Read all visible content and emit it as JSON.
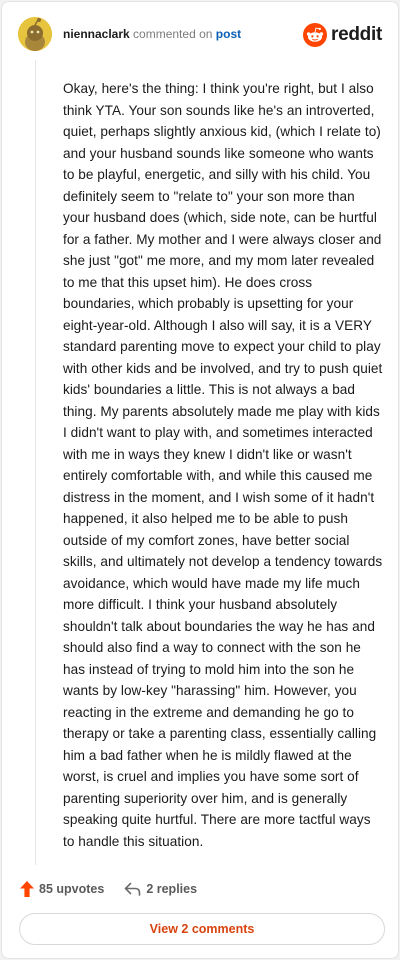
{
  "comment": {
    "username": "niennaclark",
    "action_text": "commented on",
    "post_link": "post",
    "body": "Okay, here's the thing: I think you're right, but I also think YTA. Your son sounds like he's an introverted, quiet, perhaps slightly anxious kid, (which I relate to) and your husband sounds like someone who wants to be playful, energetic, and silly with his child. You definitely seem to \"relate to\" your son more than your husband does (which, side note, can be hurtful for a father. My mother and I were always closer and she just \"got\" me more, and my mom later revealed to me that this upset him). He does cross boundaries, which probably is upsetting for your eight-year-old. Although I also will say, it is a VERY standard parenting move to expect your child to play with other kids and be involved, and try to push quiet kids' boundaries a little. This is not always a bad thing. My parents absolutely made me play with kids I didn't want to play with, and sometimes interacted with me in ways they knew I didn't like or wasn't entirely comfortable with, and while this caused me distress in the moment, and I wish some of it hadn't happened, it also helped me to be able to push outside of my comfort zones, have better social skills, and ultimately not develop a tendency towards avoidance, which would have made my life much more difficult. I think your husband absolutely shouldn't talk about boundaries the way he has and should also find a way to connect with the son he has instead of trying to mold him into the son he wants by low-key \"harassing\" him. However, you reacting in the extreme and demanding he go to therapy or take a parenting class, essentially calling him a bad father when he is mildly flawed at the worst, is cruel and implies you have some sort of parenting superiority over him, and is generally speaking quite hurtful. There are more tactful ways to handle this situation.",
    "upvotes": "85 upvotes",
    "replies": "2 replies",
    "view_comments": "View 2 comments"
  },
  "brand": {
    "name": "reddit"
  },
  "icons": {
    "upvote": "upvote-arrow-icon",
    "reply": "reply-arrow-icon",
    "logo": "reddit-snoo-icon",
    "avatar": "snoo-avatar"
  },
  "colors": {
    "accent": "#d8440f",
    "link": "#0a5fb4",
    "reddit_orange": "#ff4500",
    "avatar_bg": "#e7c43e"
  }
}
